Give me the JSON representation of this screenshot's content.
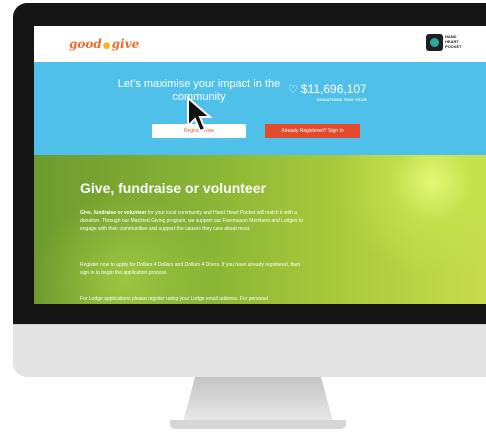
{
  "site": {
    "logo_left": "good",
    "logo_dot": "●",
    "logo_right": "give",
    "partner_name_lines": [
      "HAND",
      "HEART",
      "POCKET"
    ]
  },
  "hero": {
    "title": "Let’s maximise your impact in the community",
    "amount": "$11,696,107",
    "amount_label": "DONATIONS THIS YEAR",
    "heart_icon": "heart-outline-icon",
    "register_button": "Register Now",
    "signin_button": "Already Registered? Sign In"
  },
  "content": {
    "heading": "Give, fundraise or volunteer",
    "p1_bold": "Give, fundraise or volunteer",
    "p1_rest": " for your local community and Hand Heart Pocket will match it with a donation. Through our Matched Giving program, we support our Freemason Members and Lodges to engage with their communities and support the causes they care about most.",
    "p2": "Register now to apply for Dollars 4 Dollars and Dollars 4 Doers. If you have already registered, then sign in to begin the application process.",
    "p3": "For Lodge applications please register using your Lodge email address. For personal"
  },
  "colors": {
    "hero_blue": "#4ec0ea",
    "brand_orange": "#f06a2a",
    "signin_red": "#e34a2c",
    "green": "#86b235"
  }
}
